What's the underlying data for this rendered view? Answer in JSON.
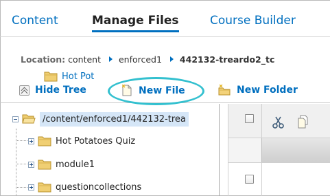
{
  "tabs": [
    {
      "label": "Content",
      "active": false
    },
    {
      "label": "Manage Files",
      "active": true
    },
    {
      "label": "Course Builder",
      "active": false
    }
  ],
  "location": {
    "label": "Location:",
    "crumbs": [
      "content",
      "enforced1",
      "442132-treardo2_tc"
    ]
  },
  "toolbar": {
    "hide_tree": "Hide Tree",
    "new_file": "New File",
    "new_folder": "New Folder"
  },
  "tree": {
    "root": "/content/enforced1/442132-trea",
    "children": [
      "Hot Potatoes Quiz",
      "module1",
      "questioncollections"
    ]
  },
  "file_list": {
    "rows": [
      {
        "name": "Hot Pot"
      }
    ]
  },
  "colors": {
    "link": "#006fbf",
    "highlight_ring": "#33c0cf",
    "tree_selection": "#d5e6f7",
    "folder": "#e8c35a"
  }
}
